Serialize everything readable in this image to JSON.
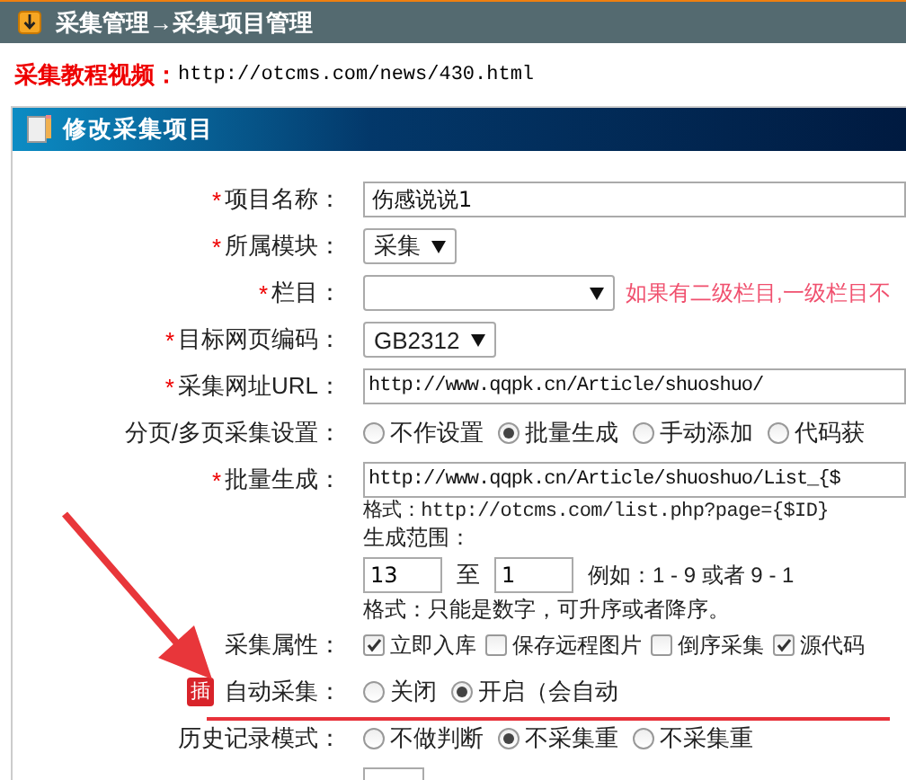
{
  "breadcrumb": "采集管理→采集项目管理",
  "tutorial": {
    "label": "采集教程视频：",
    "url": "http://otcms.com/news/430.html"
  },
  "panel": {
    "title": "修改采集项目"
  },
  "rows": [
    {
      "kind": "text",
      "required_mark": "*",
      "label": "项目名称：",
      "value": "伤感说说1"
    },
    {
      "kind": "select",
      "required_mark": "*",
      "label": "所属模块：",
      "value": "采集"
    },
    {
      "kind": "select",
      "required_mark": "*",
      "label": "栏目：",
      "wide": true,
      "hint": "如果有二级栏目,一级栏目不"
    },
    {
      "kind": "select",
      "required_mark": "*",
      "label": "目标网页编码：",
      "value": "GB2312"
    },
    {
      "kind": "text",
      "required_mark": "*",
      "label": "采集网址URL：",
      "value": "http://www.qqpk.cn/Article/shuoshuo/"
    },
    {
      "kind": "radio",
      "label": "分页/多页采集设置：",
      "options": [
        {
          "label": "不作设置",
          "selected": false
        },
        {
          "label": "批量生成",
          "selected": true
        },
        {
          "label": "手动添加",
          "selected": false
        },
        {
          "label": "代码获",
          "selected": false
        }
      ]
    },
    {
      "kind": "batch",
      "required_mark": "*",
      "label": "批量生成：",
      "value": "http://www.qqpk.cn/Article/shuoshuo/List_{$",
      "format": "格式：http://otcms.com/list.php?page={$ID}",
      "range_label": "生成范围：",
      "from": "13",
      "to_label": "至",
      "to": "1",
      "example": "例如：1 - 9 或者 9 - 1",
      "note": "格式：只能是数字，可升序或者降序。"
    },
    {
      "kind": "checkbox",
      "label": "采集属性：",
      "options": [
        {
          "label": "立即入库",
          "checked": true
        },
        {
          "label": "保存远程图片",
          "checked": false
        },
        {
          "label": "倒序采集",
          "checked": false
        },
        {
          "label": "源代码",
          "checked": true
        }
      ]
    },
    {
      "kind": "radio",
      "badge": "插",
      "label": "自动采集：",
      "highlighted": true,
      "options": [
        {
          "label": "关闭",
          "selected": false
        },
        {
          "label": "开启（会自动",
          "selected": true
        }
      ]
    },
    {
      "kind": "radio",
      "label": "历史记录模式：",
      "options": [
        {
          "label": "不做判断",
          "selected": false
        },
        {
          "label": "不采集重",
          "selected": true
        },
        {
          "label": "不采集重",
          "selected": false
        }
      ]
    },
    {
      "kind": "short"
    }
  ]
}
